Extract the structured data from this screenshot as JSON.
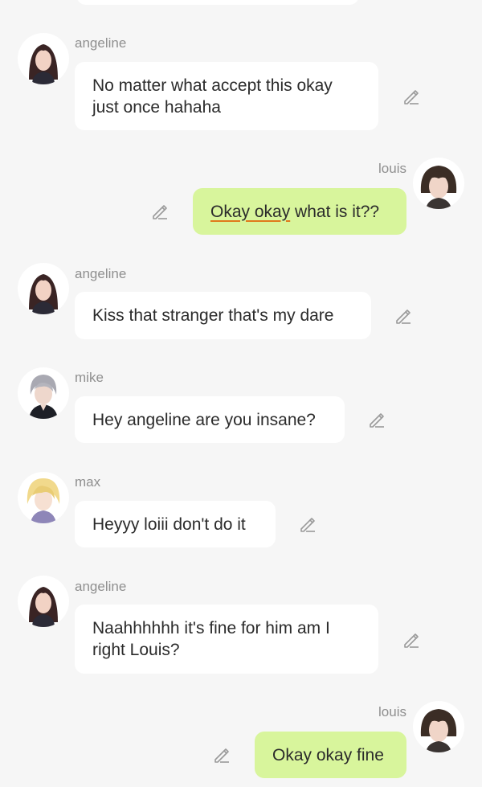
{
  "colors": {
    "background": "#f6f6f6",
    "incoming_bubble": "#ffffff",
    "outgoing_bubble": "#d8f59c",
    "name_text": "#8f8f8f",
    "spellcheck_underline": "#e07a1c"
  },
  "messages": [
    {
      "sender": "angeline",
      "text": "No matter what accept this okay\njust once hahaha",
      "direction": "incoming"
    },
    {
      "sender": "louis",
      "text_underlined": "Okay okay",
      "text_rest": " what is it??",
      "direction": "outgoing"
    },
    {
      "sender": "angeline",
      "text": "Kiss that stranger that's my dare",
      "direction": "incoming"
    },
    {
      "sender": "mike",
      "text": "Hey angeline are you insane?",
      "direction": "incoming"
    },
    {
      "sender": "max",
      "text": "Heyyy loiii don't do it",
      "direction": "incoming"
    },
    {
      "sender": "angeline",
      "text": "Naahhhhhh it's fine for him am I\nright Louis?",
      "direction": "incoming"
    },
    {
      "sender": "louis",
      "text": "Okay okay fine",
      "direction": "outgoing"
    }
  ],
  "icons": {
    "edit": "pencil-icon",
    "avatar": "avatar-icon"
  }
}
